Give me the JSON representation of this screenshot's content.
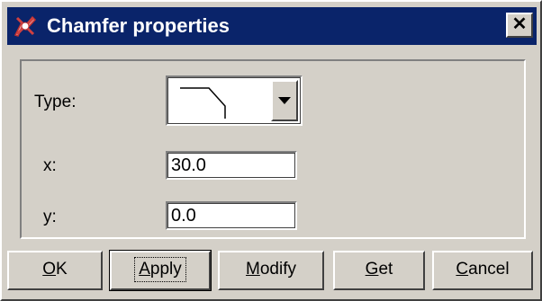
{
  "window": {
    "title": "Chamfer properties",
    "close_glyph": "✕"
  },
  "form": {
    "type_label": "Type:",
    "x_label": "x:",
    "y_label": "y:",
    "x_value": "30.0",
    "y_value": "0.0",
    "type_icon": "chamfer-profile-icon"
  },
  "buttons": {
    "ok": {
      "accel": "O",
      "rest": "K"
    },
    "apply": {
      "accel": "A",
      "rest": "pply"
    },
    "modify": {
      "accel": "M",
      "rest": "odify"
    },
    "get": {
      "accel": "G",
      "rest": "et"
    },
    "cancel": {
      "accel": "C",
      "rest": "ancel"
    }
  },
  "colors": {
    "titlebar": "#0a246a",
    "face": "#d4d0c8"
  }
}
